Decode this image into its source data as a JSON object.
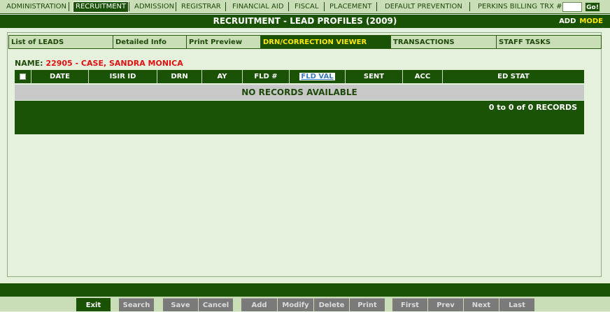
{
  "top_nav": {
    "items": [
      "ADMINISTRATION",
      "RECRUITMENT",
      "ADMISSION",
      "REGISTRAR",
      "FINANCIAL AID",
      "FISCAL",
      "PLACEMENT",
      "DEFAULT PREVENTION",
      "PERKINS BILLING"
    ],
    "active_item": "RECRUITMENT",
    "trx_label": "TRX #:",
    "trx_value": "",
    "go_label": "Go!"
  },
  "header": {
    "title": "RECRUITMENT - LEAD PROFILES (2009)",
    "add_label": "ADD",
    "mode_label": "MODE"
  },
  "tabs": [
    "List of LEADS",
    "Detailed Info",
    "Print Preview",
    "DRN/CORRECTION VIEWER",
    "TRANSACTIONS",
    "STAFF TASKS"
  ],
  "active_tab": "DRN/CORRECTION VIEWER",
  "record": {
    "name_label": "NAME:",
    "name_value": "22905 - CASE, SANDRA MONICA"
  },
  "table": {
    "columns": [
      "DATE",
      "ISIR ID",
      "DRN",
      "AY",
      "FLD #",
      "FLD VAL",
      "SENT",
      "ACC",
      "ED STAT"
    ],
    "empty_message": "NO RECORDS AVAILABLE",
    "record_count": "0 to 0 of 0 RECORDS"
  },
  "toolbar": {
    "exit": "Exit",
    "search": "Search",
    "save": "Save",
    "cancel": "Cancel",
    "add": "Add",
    "modify": "Modify",
    "delete": "Delete",
    "print": "Print",
    "first": "First",
    "prev": "Prev",
    "next": "Next",
    "last": "Last"
  }
}
